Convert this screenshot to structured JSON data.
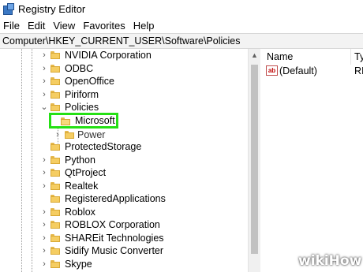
{
  "window": {
    "title": "Registry Editor",
    "icon": "registry-editor-icon"
  },
  "menu": [
    "File",
    "Edit",
    "View",
    "Favorites",
    "Help"
  ],
  "address": "Computer\\HKEY_CURRENT_USER\\Software\\Policies",
  "tree": {
    "rows_before": [
      {
        "label": "NVIDIA Corporation",
        "expander": "›"
      },
      {
        "label": "ODBC",
        "expander": "›"
      },
      {
        "label": "OpenOffice",
        "expander": "›"
      },
      {
        "label": "Piriform",
        "expander": "›"
      },
      {
        "label": "Policies",
        "expander": "⌄"
      }
    ],
    "selected": {
      "label": "Microsoft"
    },
    "power": {
      "label": "Power",
      "expander": "›"
    },
    "rows_after": [
      {
        "label": "ProtectedStorage",
        "expander": ""
      },
      {
        "label": "Python",
        "expander": "›"
      },
      {
        "label": "QtProject",
        "expander": "›"
      },
      {
        "label": "Realtek",
        "expander": "›"
      },
      {
        "label": "RegisteredApplications",
        "expander": ""
      },
      {
        "label": "Roblox",
        "expander": "›"
      },
      {
        "label": "ROBLOX Corporation",
        "expander": "›"
      },
      {
        "label": "SHAREit Technologies",
        "expander": "›"
      },
      {
        "label": "Sidify Music Converter",
        "expander": "›"
      },
      {
        "label": "Skype",
        "expander": "›"
      }
    ]
  },
  "values_pane": {
    "columns": {
      "name": "Name",
      "type": "Ty"
    },
    "rows": [
      {
        "icon": "ab",
        "name": "(Default)",
        "type": "RI"
      }
    ]
  },
  "watermark": {
    "wiki": "wiki",
    "how": "How"
  },
  "colors": {
    "highlight_box": "#25e014",
    "folder": "#f5cd62"
  }
}
